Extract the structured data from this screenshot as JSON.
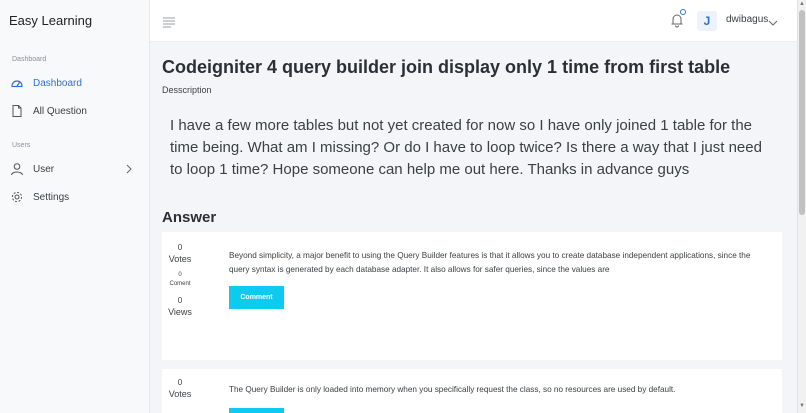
{
  "app": {
    "brand": "Easy Learning"
  },
  "sidebar": {
    "sections": [
      {
        "label": "Dashboard",
        "items": [
          {
            "label": "Dashboard",
            "icon": "dashboard-icon",
            "active": true
          },
          {
            "label": "All Question",
            "icon": "document-icon",
            "active": false
          }
        ]
      },
      {
        "label": "Users",
        "items": [
          {
            "label": "User",
            "icon": "user-icon",
            "active": false,
            "has_chevron": true
          },
          {
            "label": "Settings",
            "icon": "gear-icon",
            "active": false
          }
        ]
      }
    ]
  },
  "header": {
    "menu_icon": "menu-icon",
    "bell_icon": "bell-icon",
    "avatar_initial": "J",
    "username": "dwibagus"
  },
  "question": {
    "title": "Codeigniter 4 query builder join display only 1 time from first table",
    "description_label": "Desscription",
    "body": "I have a few more tables but not yet created for now so I have only joined 1 table for the time being. What am I missing? Or do I have to loop twice? Is there a way that I just need to loop 1 time? Hope someone can help me out here. Thanks in advance guys"
  },
  "answers_heading": "Answer",
  "answers": [
    {
      "votes": "0",
      "votes_label": "Votes",
      "comments": "0",
      "comments_label": "Coment",
      "views": "0",
      "views_label": "Views",
      "text": "Beyond simplicity, a major benefit to using the Query Builder features is that it allows you to create database independent applications, since the query syntax is generated by each database adapter. It also allows for safer queries, since the values are",
      "comment_button": "Comment"
    },
    {
      "votes": "0",
      "votes_label": "Votes",
      "text": "The Query Builder is only loaded into memory when you specifically request the class, so no resources are used by default."
    }
  ],
  "colors": {
    "accent": "#2f6fd6",
    "button": "#0dcaf0"
  }
}
